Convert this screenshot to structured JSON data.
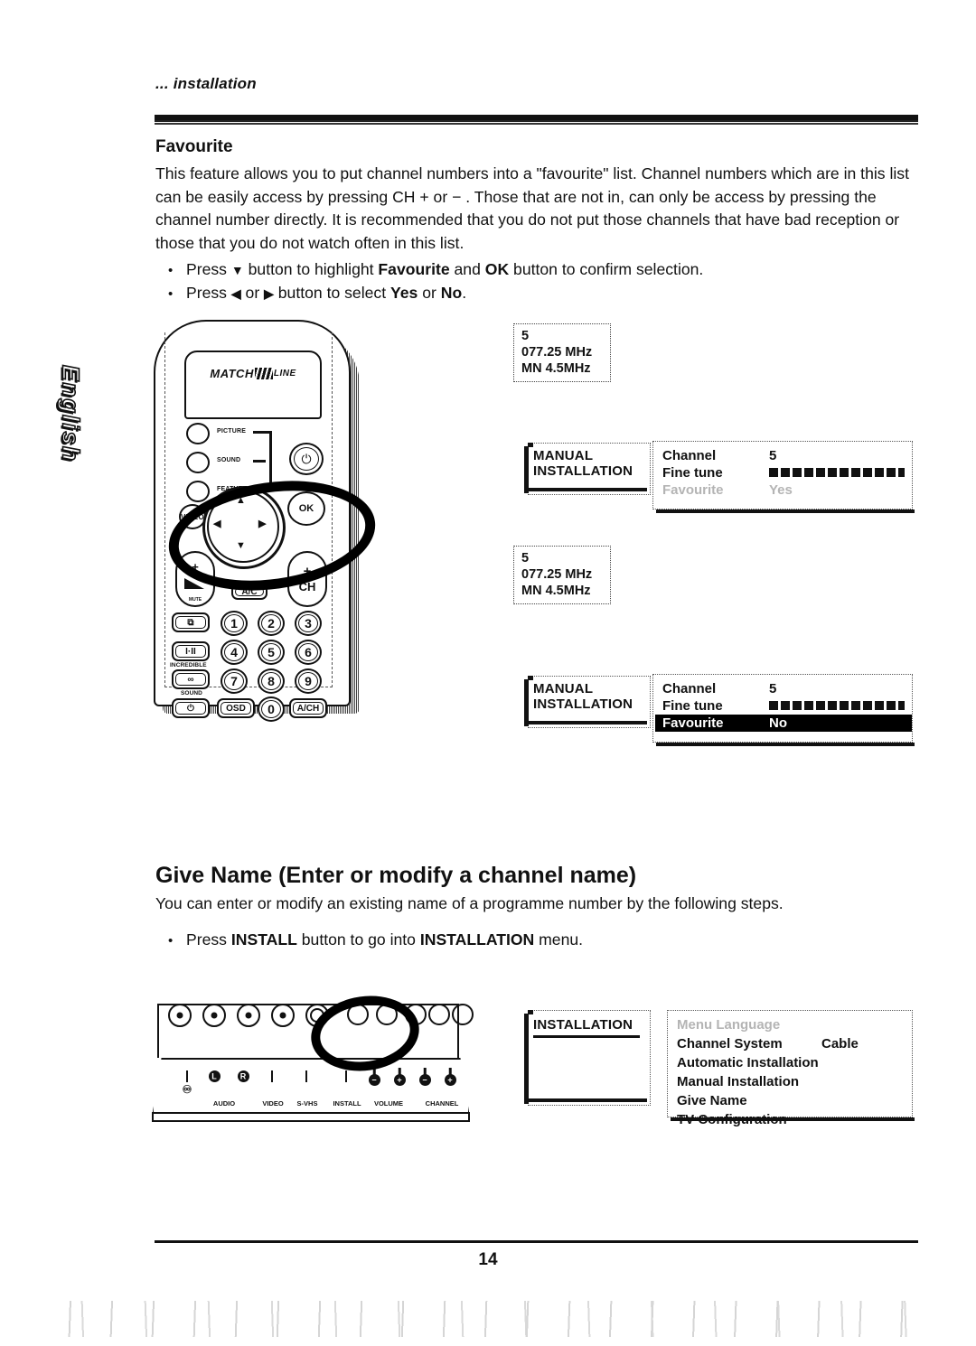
{
  "page": {
    "running_head": "... installation",
    "page_number": "14",
    "side_tab": "English"
  },
  "favourite_section": {
    "title": "Favourite",
    "paragraph": "This feature allows you to put channel numbers into a \"favourite\" list.  Channel numbers which are in this list can be easily access by pressing  CH  +  or − . Those that are not in, can only be access by pressing the channel number directly.  It is recommended that you do not put those channels that have bad reception or those that you do not watch often in this list.",
    "bullets": [
      {
        "pre": "Press",
        "glyph": "▼",
        "mid": "button to highlight",
        "bold1": "Favourite",
        "conj": "and",
        "bold2": "OK",
        "post": "button to confirm selection."
      },
      {
        "pre": "Press",
        "glyph": "◀",
        "glyph_conj": "or",
        "glyph2": "▶",
        "mid": "button to select",
        "bold1": "Yes",
        "conj": "or",
        "bold2": "No",
        "post": "."
      }
    ]
  },
  "give_name_section": {
    "title": "Give Name (Enter or modify a channel name)",
    "paragraph": "You can enter or modify an existing name of a programme number by the following steps.",
    "bullet": {
      "pre": "Press",
      "bold1": "INSTALL",
      "mid": "button to go into",
      "bold2": "INSTALLATION",
      "post": "menu."
    }
  },
  "remote": {
    "logo_left": "MATCH",
    "logo_right": "LINE",
    "mode_buttons": [
      "PICTURE",
      "SOUND",
      "FEATURE"
    ],
    "video_label": "VIDEO",
    "ok_label": "OK",
    "power_glyph": "⏻",
    "volume": {
      "plus": "+",
      "minus": "−",
      "mute_label": "MUTE"
    },
    "channel": {
      "plus": "+",
      "label": "CH",
      "minus": "−"
    },
    "aux_label": "A/C",
    "function_buttons": [
      {
        "label": "⧉",
        "caption_above": "",
        "caption_below": ""
      },
      {
        "label": "I·II",
        "caption_above": "",
        "caption_below": ""
      },
      {
        "label": "∞",
        "caption_above": "INCREDIBLE",
        "caption_below": "SOUND"
      },
      {
        "label": "⏻",
        "caption_above": "",
        "caption_below": ""
      }
    ],
    "keypad": [
      "1",
      "2",
      "3",
      "4",
      "5",
      "6",
      "7",
      "8",
      "9"
    ],
    "bottom_row": [
      "OSD",
      "0",
      "A/CH"
    ],
    "nav_arrows": [
      "▲",
      "◀",
      "▶",
      "▼"
    ]
  },
  "osd": {
    "freq_display_1": {
      "line1": "5",
      "line2": "077.25  MHz",
      "line3": "MN  4.5MHz"
    },
    "freq_display_2": {
      "line1": "5",
      "line2": "077.25  MHz",
      "line3": "MN  4.5MHz"
    },
    "manual_install_title_1": "MANUAL INSTALLATION",
    "manual_install_title_2": "MANUAL INSTALLATION",
    "panel_1": {
      "rows": [
        {
          "label": "Channel",
          "value": "5",
          "state": "normal"
        },
        {
          "label": "Fine  tune",
          "value": "meter",
          "state": "normal"
        },
        {
          "label": "Favourite",
          "value": "Yes",
          "state": "faded"
        }
      ]
    },
    "panel_2": {
      "rows": [
        {
          "label": "Channel",
          "value": "5",
          "state": "normal"
        },
        {
          "label": "Fine  tune",
          "value": "meter",
          "state": "normal"
        },
        {
          "label": "Favourite",
          "value": "No",
          "state": "highlighted"
        }
      ]
    },
    "installation_title": "INSTALLATION",
    "installation_rows": [
      {
        "label": "Menu Language",
        "value": "",
        "state": "faded"
      },
      {
        "label": "Channel System",
        "value": "Cable",
        "state": "normal"
      },
      {
        "label": "Automatic Installation",
        "value": "",
        "state": "normal"
      },
      {
        "label": "Manual Installation",
        "value": "",
        "state": "normal"
      },
      {
        "label": "Give Name",
        "value": "",
        "state": "normal"
      },
      {
        "label": "TV Configuration",
        "value": "",
        "state": "normal"
      }
    ]
  },
  "tv_panel": {
    "controls": [
      {
        "name": "headphone",
        "label": "",
        "icon": "☎"
      },
      {
        "name": "audio-l",
        "label": "",
        "icon": "L"
      },
      {
        "name": "audio-r",
        "label": "",
        "icon": "R"
      },
      {
        "name": "audio-group",
        "label": "AUDIO"
      },
      {
        "name": "video",
        "label": "VIDEO"
      },
      {
        "name": "svhs",
        "label": "S-VHS"
      },
      {
        "name": "install",
        "label": "INSTALL"
      },
      {
        "name": "volume",
        "label": "VOLUME"
      },
      {
        "name": "channel",
        "label": "CHANNEL"
      }
    ],
    "labels": [
      "AUDIO",
      "VIDEO",
      "S-VHS",
      "INSTALL",
      "VOLUME",
      "CHANNEL"
    ]
  }
}
